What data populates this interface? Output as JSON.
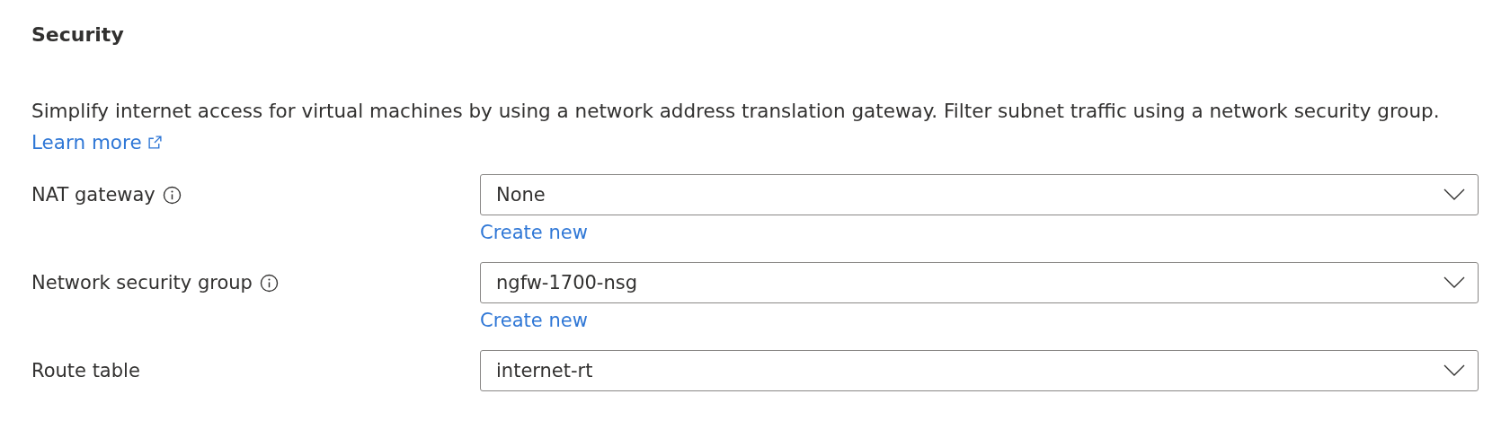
{
  "section": {
    "title": "Security",
    "description": "Simplify internet access for virtual machines by using a network address translation gateway. Filter subnet traffic using a network security group.",
    "learn_more": "Learn more"
  },
  "fields": [
    {
      "label": "NAT gateway",
      "info": true,
      "value": "None",
      "create_link": "Create new"
    },
    {
      "label": "Network security group",
      "info": true,
      "value": "ngfw-1700-nsg",
      "create_link": "Create new"
    },
    {
      "label": "Route table",
      "info": false,
      "value": "internet-rt"
    }
  ]
}
